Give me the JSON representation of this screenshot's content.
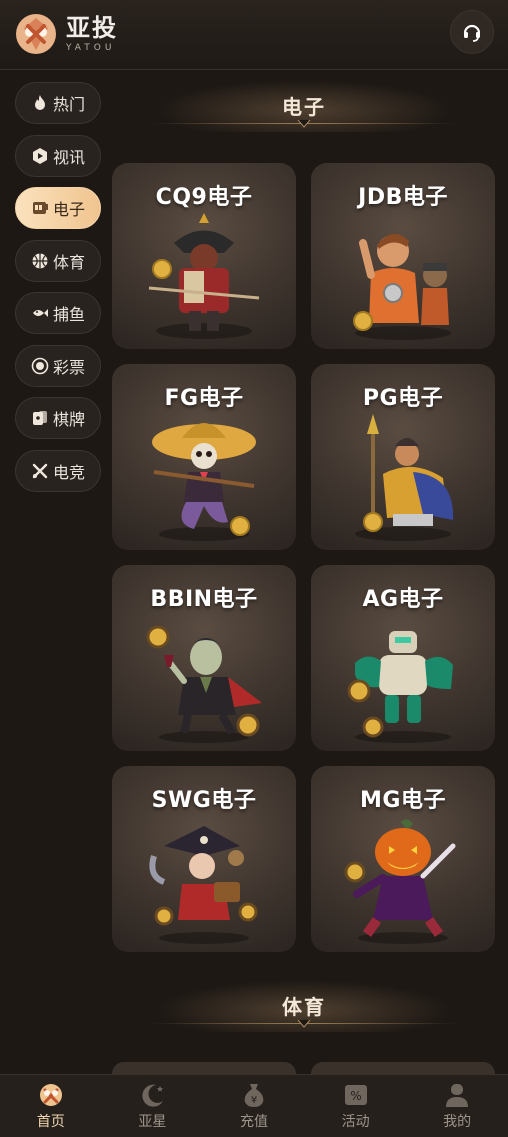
{
  "brand": {
    "name_cn": "亚投",
    "name_en": "YATOU"
  },
  "colors": {
    "accent": "#f0c48f",
    "background": "#1d1814",
    "card": "#40362f"
  },
  "sidebar": {
    "items": [
      {
        "label": "热门",
        "icon": "fire-icon"
      },
      {
        "label": "视讯",
        "icon": "play-icon"
      },
      {
        "label": "电子",
        "icon": "slot-machine-icon",
        "active": true
      },
      {
        "label": "体育",
        "icon": "basketball-icon"
      },
      {
        "label": "捕鱼",
        "icon": "fish-icon"
      },
      {
        "label": "彩票",
        "icon": "lottery-icon"
      },
      {
        "label": "棋牌",
        "icon": "cards-icon"
      },
      {
        "label": "电竞",
        "icon": "esports-icon"
      }
    ]
  },
  "sections": [
    {
      "title": "电子"
    },
    {
      "title": "体育"
    }
  ],
  "games": [
    {
      "label": "CQ9电子",
      "art": "samurai-icon"
    },
    {
      "label": "JDB电子",
      "art": "soldier-icon"
    },
    {
      "label": "FG电子",
      "art": "mariachi-skeleton-icon"
    },
    {
      "label": "PG电子",
      "art": "warrior-spear-icon"
    },
    {
      "label": "BBIN电子",
      "art": "vampire-icon"
    },
    {
      "label": "AG电子",
      "art": "robot-icon"
    },
    {
      "label": "SWG电子",
      "art": "pirate-icon"
    },
    {
      "label": "MG电子",
      "art": "pumpkin-icon"
    }
  ],
  "bottom_nav": [
    {
      "label": "首页",
      "icon": "home-logo-icon",
      "active": true
    },
    {
      "label": "亚星",
      "icon": "moon-star-icon"
    },
    {
      "label": "充值",
      "icon": "money-bag-icon"
    },
    {
      "label": "活动",
      "icon": "coupon-icon"
    },
    {
      "label": "我的",
      "icon": "user-icon"
    }
  ]
}
